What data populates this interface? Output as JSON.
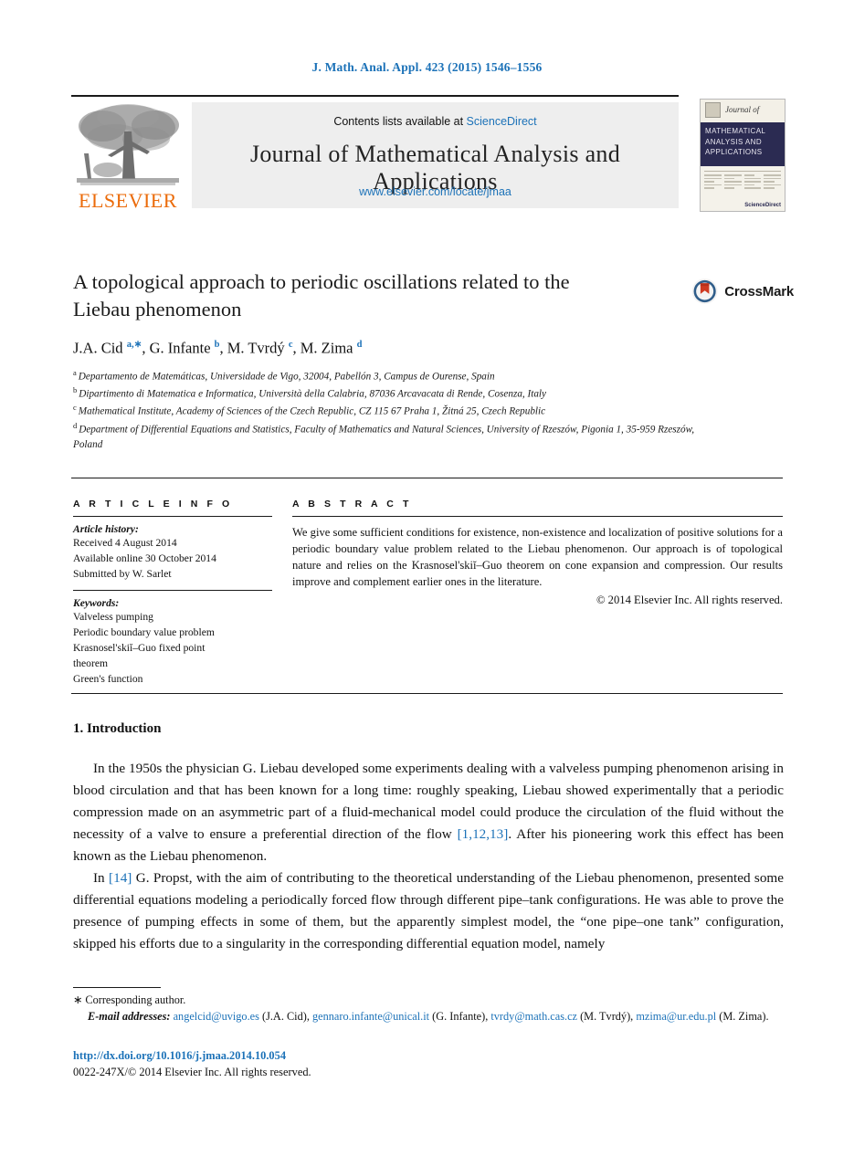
{
  "running_head": "J. Math. Anal. Appl. 423 (2015) 1546–1556",
  "masthead": {
    "contents_prefix": "Contents lists available at ",
    "sciencedirect": "ScienceDirect",
    "journal_title": "Journal of Mathematical Analysis and Applications",
    "journal_url": "www.elsevier.com/locate/jmaa",
    "publisher_logo_text": "ELSEVIER",
    "cover": {
      "journal_of": "Journal of",
      "cover_title": "MATHEMATICAL ANALYSIS AND APPLICATIONS",
      "cover_footer": "ScienceDirect"
    }
  },
  "article": {
    "title": "A topological approach to periodic oscillations related to the Liebau phenomenon",
    "crossmark_label": "CrossMark",
    "authors_html": "J.A. Cid <sup class=\"aff-mark\">a,∗</sup>, G. Infante <sup class=\"aff-mark\">b</sup>, M. Tvrdý <sup class=\"aff-mark\">c</sup>, M. Zima <sup class=\"aff-mark\">d</sup>",
    "affiliations": [
      {
        "mark": "a",
        "text": "Departamento de Matemáticas, Universidade de Vigo, 32004, Pabellón 3, Campus de Ourense, Spain"
      },
      {
        "mark": "b",
        "text": "Dipartimento di Matematica e Informatica, Università della Calabria, 87036 Arcavacata di Rende, Cosenza, Italy"
      },
      {
        "mark": "c",
        "text": "Mathematical Institute, Academy of Sciences of the Czech Republic, CZ 115 67 Praha 1, Žitná 25, Czech Republic"
      },
      {
        "mark": "d",
        "text": "Department of Differential Equations and Statistics, Faculty of Mathematics and Natural Sciences, University of Rzeszów, Pigonia 1, 35-959 Rzeszów, Poland"
      }
    ]
  },
  "info": {
    "heading": "A R T I C L E   I N F O",
    "history_label": "Article history:",
    "history": [
      "Received 4 August 2014",
      "Available online 30 October 2014",
      "Submitted by W. Sarlet"
    ],
    "keywords_label": "Keywords:",
    "keywords": [
      "Valveless pumping",
      "Periodic boundary value problem",
      "Krasnosel'skiĭ–Guo fixed point",
      "theorem",
      "Green's function"
    ]
  },
  "abstract": {
    "heading": "A B S T R A C T",
    "text": "We give some sufficient conditions for existence, non-existence and localization of positive solutions for a periodic boundary value problem related to the Liebau phenomenon. Our approach is of topological nature and relies on the Krasnosel'skiĭ–Guo theorem on cone expansion and compression. Our results improve and complement earlier ones in the literature.",
    "copyright": "© 2014 Elsevier Inc. All rights reserved."
  },
  "body": {
    "section_heading": "1. Introduction",
    "paragraph1_html": "In the 1950s the physician G. Liebau developed some experiments dealing with a valveless pumping phenomenon arising in blood circulation and that has been known for a long time: roughly speaking, Liebau showed experimentally that a periodic compression made on an asymmetric part of a fluid-mechanical model could produce the circulation of the fluid without the necessity of a valve to ensure a preferential direction of the flow <span class=\"cite\">[1,12,13]</span>. After his pioneering work this effect has been known as the Liebau phenomenon.",
    "paragraph2_html": "In <span class=\"cite\">[14]</span> G. Propst, with the aim of contributing to the theoretical understanding of the Liebau phenomenon, presented some differential equations modeling a periodically forced flow through different pipe–tank configurations. He was able to prove the presence of pumping effects in some of them, but the apparently simplest model, the “one pipe–one tank” configuration, skipped his efforts due to a singularity in the corresponding differential equation model, namely"
  },
  "footnotes": {
    "corresponding": "∗  Corresponding author.",
    "email_label": "E-mail addresses:",
    "emails_html": " <span class=\"email\">angelcid@uvigo.es</span> (J.A. Cid), <span class=\"email\">gennaro.infante@unical.it</span> (G. Infante), <span class=\"email\">tvrdy@math.cas.cz</span> (M. Tvrdý), <span class=\"email\">mzima@ur.edu.pl</span> (M. Zima).",
    "doi": "http://dx.doi.org/10.1016/j.jmaa.2014.10.054",
    "issn_line": "0022-247X/© 2014 Elsevier Inc. All rights reserved."
  },
  "colors": {
    "link_blue": "#1c72b8",
    "elsevier_orange": "#eb6b0a",
    "cover_navy": "#2b2b52",
    "band_grey": "#eeeeee"
  }
}
